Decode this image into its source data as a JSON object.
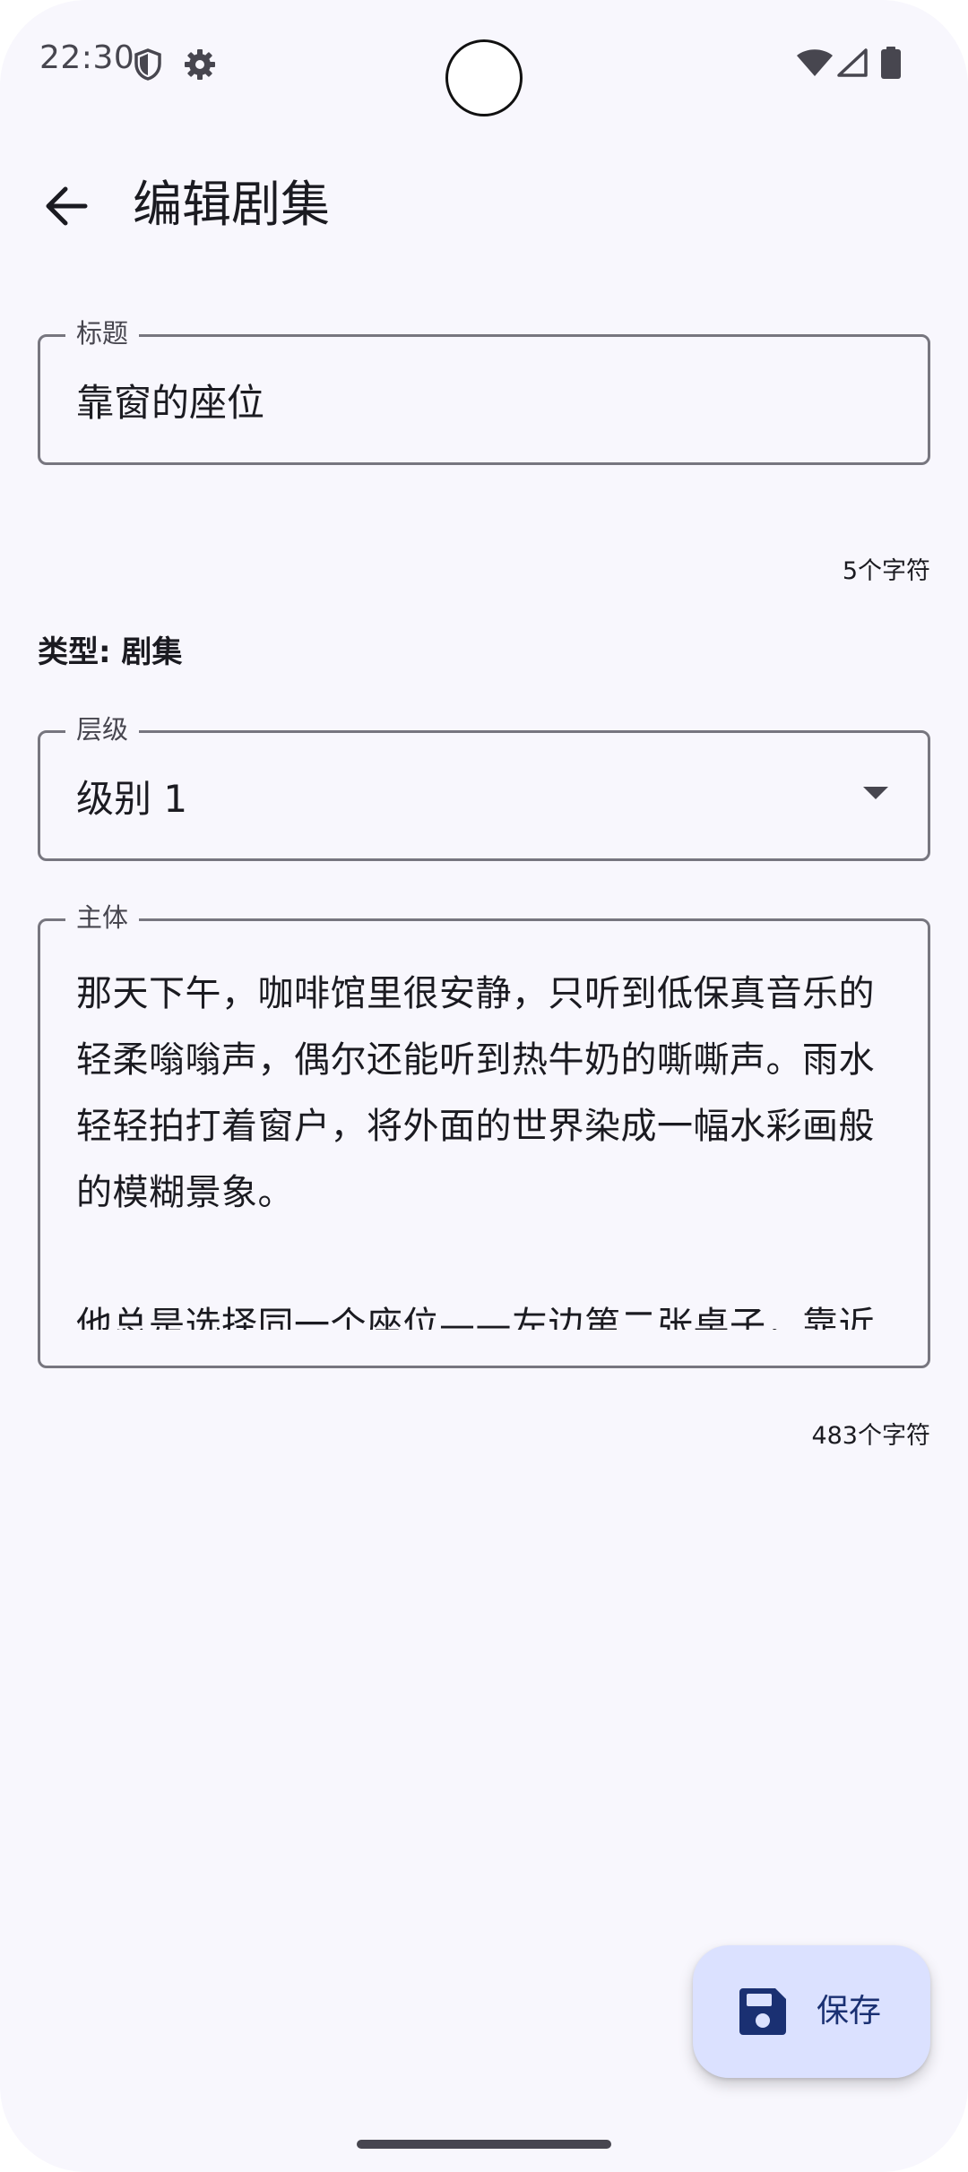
{
  "status_bar": {
    "time": "22:30",
    "icons": [
      "shield-icon",
      "settings-gear-icon",
      "wifi-icon",
      "cell-signal-icon",
      "battery-icon"
    ]
  },
  "app_bar": {
    "title": "编辑剧集",
    "back_icon": "arrow-back-icon"
  },
  "title_field": {
    "label": "标题",
    "value": "靠窗的座位",
    "counter": "5个字符"
  },
  "type_line": "类型: 剧集",
  "level_field": {
    "label": "层级",
    "selected": "级别 1"
  },
  "body_field": {
    "label": "主体",
    "value": "那天下午，咖啡馆里很安静，只听到低保真音乐的轻柔嗡嗡声，偶尔还能听到热牛奶的嘶嘶声。雨水轻轻拍打着窗户，将外面的世界染成一幅水彩画般的模糊景象。\n\n他总是选择同一个座位——左边第二张桌子，靠近前面的大窗户，离柜台不远，离门也不近，正",
    "counter": "483个字符"
  },
  "fab": {
    "label": "保存",
    "icon": "save-icon"
  },
  "colors": {
    "background": "#f8f7fd",
    "outline": "#77767f",
    "fab_container": "#dbe1ff",
    "fab_content": "#1a3072"
  }
}
